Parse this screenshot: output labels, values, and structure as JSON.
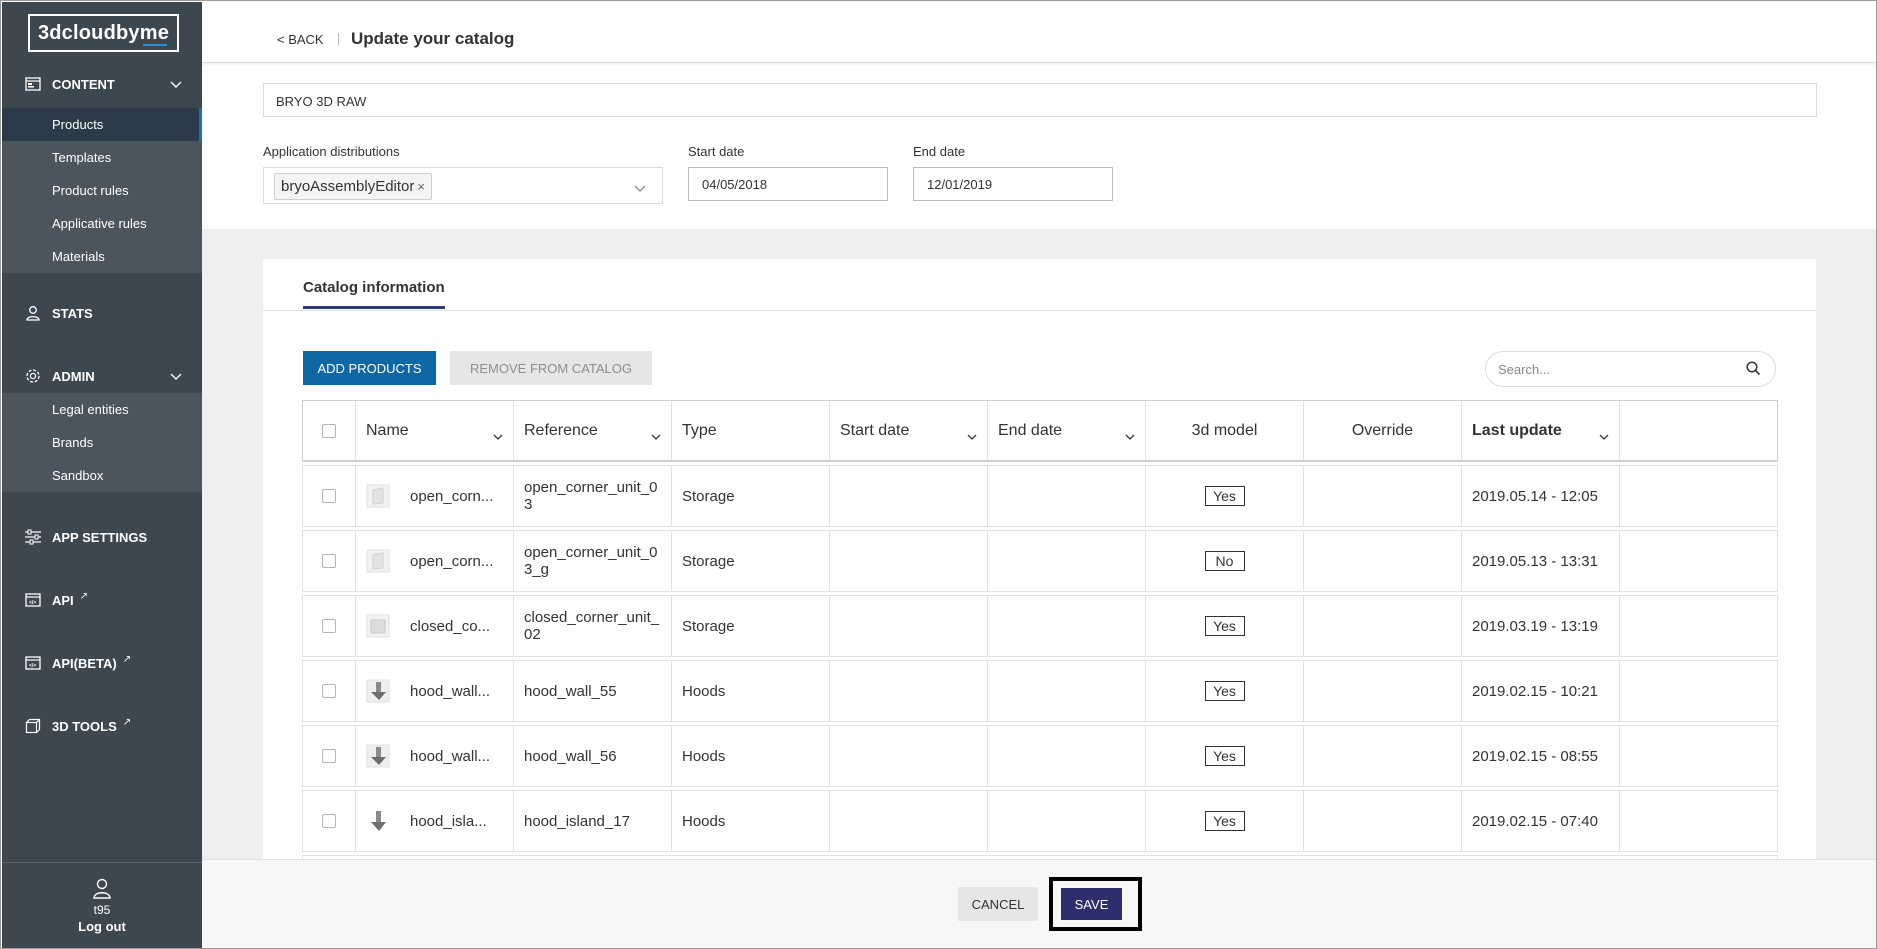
{
  "sidebar": {
    "logo": "3dcloudbyme",
    "content": {
      "label": "CONTENT",
      "items": [
        "Products",
        "Templates",
        "Product rules",
        "Applicative rules",
        "Materials"
      ],
      "active": "Products"
    },
    "stats": {
      "label": "STATS"
    },
    "admin": {
      "label": "ADMIN",
      "items": [
        "Legal entities",
        "Brands",
        "Sandbox"
      ]
    },
    "app_settings": {
      "label": "APP SETTINGS"
    },
    "api": {
      "label": "API"
    },
    "api_beta": {
      "label": "API(BETA)"
    },
    "tools": {
      "label": "3D TOOLS"
    },
    "user": {
      "name": "t95",
      "logout": "Log out"
    }
  },
  "header": {
    "back": "< BACK",
    "title": "Update your catalog"
  },
  "form": {
    "catalog_name": "BRYO 3D RAW",
    "distributions_label": "Application distributions",
    "distribution_chip": "bryoAssemblyEditor",
    "chip_remove": "×",
    "start_label": "Start date",
    "start_value": "04/05/2018",
    "end_label": "End date",
    "end_value": "12/01/2019"
  },
  "catalog": {
    "tab": "Catalog information",
    "add_button": "ADD PRODUCTS",
    "remove_button": "REMOVE FROM CATALOG",
    "search_placeholder": "Search...",
    "columns": {
      "name": "Name",
      "reference": "Reference",
      "type": "Type",
      "start_date": "Start date",
      "end_date": "End date",
      "model": "3d model",
      "override": "Override",
      "last_update": "Last update"
    },
    "rows": [
      {
        "name": "open_corn...",
        "reference": "open_corner_unit_03",
        "type": "Storage",
        "start_date": "",
        "end_date": "",
        "model": "Yes",
        "override": "",
        "last_update": "2019.05.14 - 12:05",
        "thumb": "cabinet-thumbnail-icon"
      },
      {
        "name": "open_corn...",
        "reference": "open_corner_unit_03_g",
        "type": "Storage",
        "start_date": "",
        "end_date": "",
        "model": "No",
        "override": "",
        "last_update": "2019.05.13 - 13:31",
        "thumb": "cabinet-thumbnail-icon"
      },
      {
        "name": "closed_co...",
        "reference": "closed_corner_unit_02",
        "type": "Storage",
        "start_date": "",
        "end_date": "",
        "model": "Yes",
        "override": "",
        "last_update": "2019.03.19 - 13:19",
        "thumb": "cabinet-thumbnail-icon"
      },
      {
        "name": "hood_wall...",
        "reference": "hood_wall_55",
        "type": "Hoods",
        "start_date": "",
        "end_date": "",
        "model": "Yes",
        "override": "",
        "last_update": "2019.02.15 - 10:21",
        "thumb": "hood-thumbnail-icon"
      },
      {
        "name": "hood_wall...",
        "reference": "hood_wall_56",
        "type": "Hoods",
        "start_date": "",
        "end_date": "",
        "model": "Yes",
        "override": "",
        "last_update": "2019.02.15 - 08:55",
        "thumb": "hood-thumbnail-icon"
      },
      {
        "name": "hood_isla...",
        "reference": "hood_island_17",
        "type": "Hoods",
        "start_date": "",
        "end_date": "",
        "model": "Yes",
        "override": "",
        "last_update": "2019.02.15 - 07:40",
        "thumb": "hood-thumbnail-icon"
      }
    ]
  },
  "footer": {
    "cancel": "CANCEL",
    "save": "SAVE"
  },
  "colors": {
    "sidebar": "#3c4750",
    "primary_button": "#0f67a6",
    "save_button": "#2c2f6b",
    "tab_underline": "#2f3a7a"
  }
}
